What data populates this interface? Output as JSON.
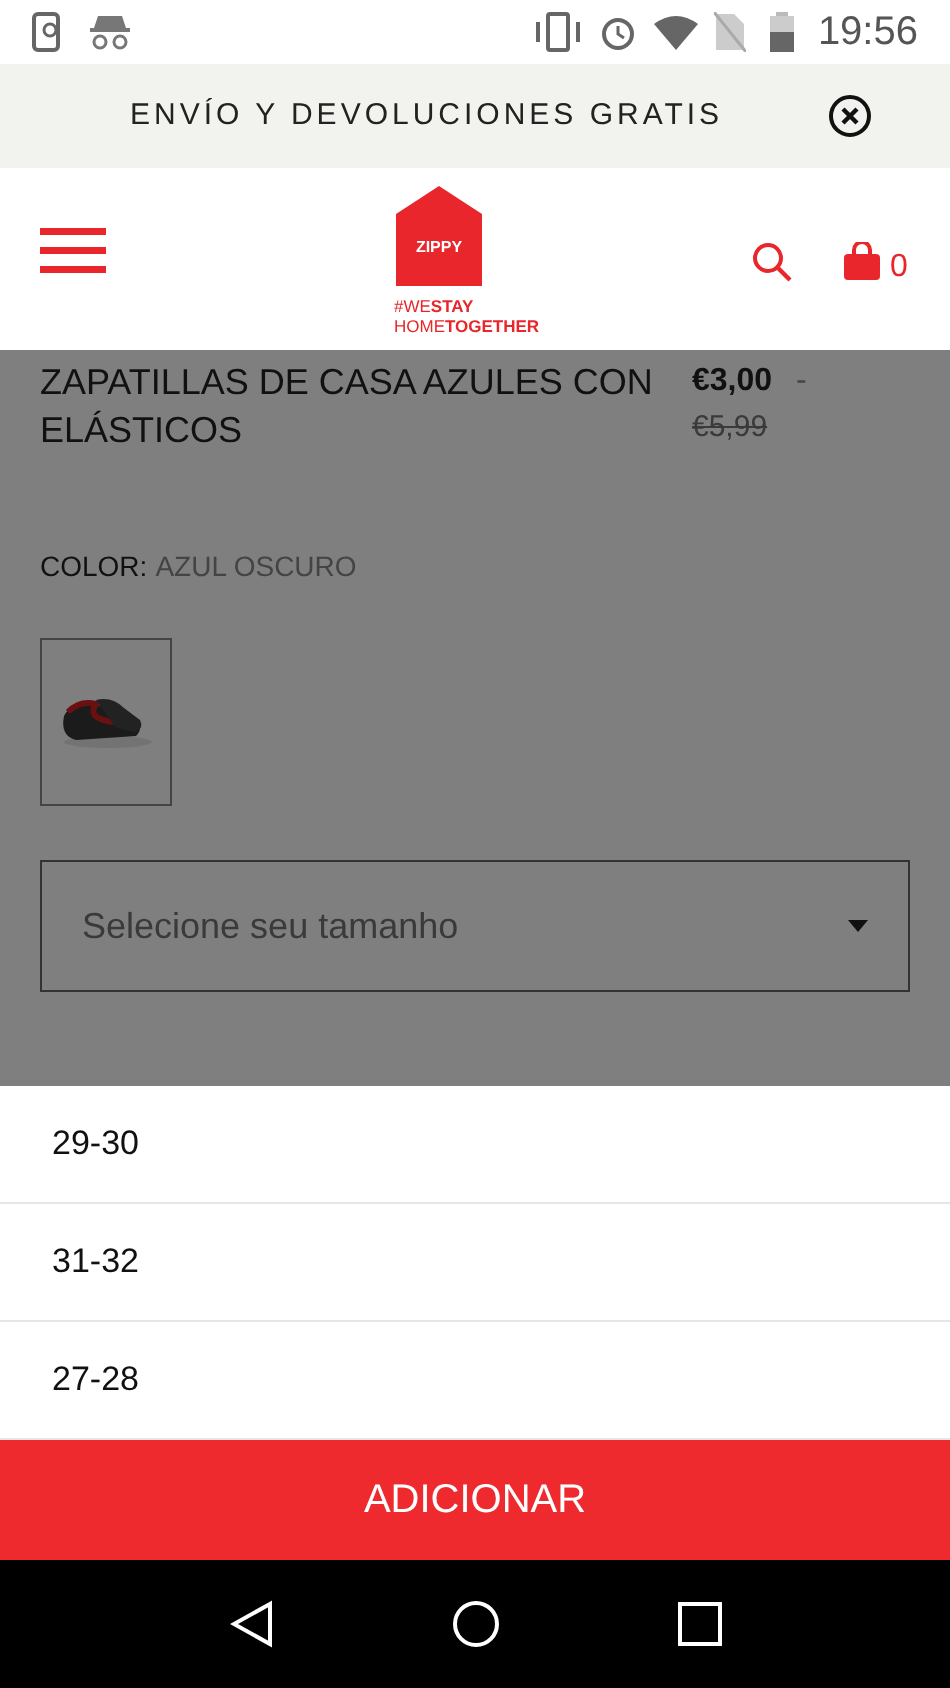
{
  "status_bar": {
    "time": "19:56"
  },
  "banner": {
    "text": "ENVÍO Y DEVOLUCIONES GRATIS"
  },
  "header": {
    "logo_text": "ZIPPY",
    "tagline": [
      "#WE**STAY**",
      "HOME**TOGETHER**"
    ],
    "cart_count": "0"
  },
  "product": {
    "title": "ZAPATILLAS DE CASA AZULES CON ELÁSTICOS",
    "price": "€3,00",
    "separator": "-",
    "old_price": "€5,99",
    "color_label": "COLOR:",
    "color_value": "AZUL OSCURO",
    "size_select": {
      "placeholder": "Selecione seu tamanho"
    }
  },
  "size_options": [
    {
      "label": "29-30"
    },
    {
      "label": "31-32"
    },
    {
      "label": "27-28"
    }
  ],
  "add_button": "ADICIONAR"
}
